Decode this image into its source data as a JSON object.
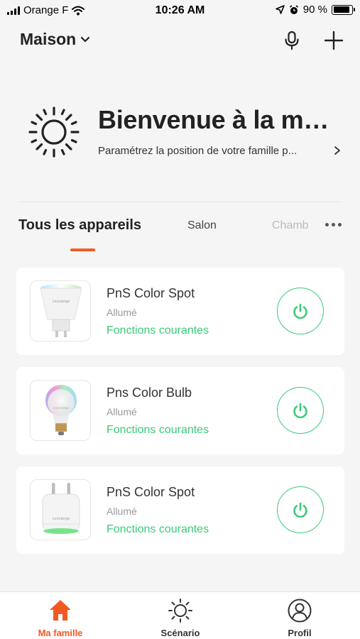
{
  "status_bar": {
    "carrier": "Orange F",
    "time": "10:26 AM",
    "battery": "90 %",
    "battery_level": 0.9
  },
  "header": {
    "home_name": "Maison"
  },
  "welcome": {
    "title": "Bienvenue à la mai...",
    "subtitle": "Paramétrez la position de votre famille p..."
  },
  "tabs": {
    "items": [
      {
        "label": "Tous les appareils",
        "active": true
      },
      {
        "label": "Salon",
        "active": false
      },
      {
        "label": "Chamb",
        "active": false
      }
    ]
  },
  "devices": [
    {
      "name": "PnS Color Spot",
      "status": "Allumé",
      "functions": "Fonctions courantes",
      "thumbnail": "spot-bulb",
      "power_on": true
    },
    {
      "name": "Pns Color Bulb",
      "status": "Allumé",
      "functions": "Fonctions courantes",
      "thumbnail": "color-bulb",
      "power_on": true
    },
    {
      "name": "PnS Color Spot",
      "status": "Allumé",
      "functions": "Fonctions courantes",
      "thumbnail": "smart-plug",
      "power_on": true
    }
  ],
  "bottom_nav": {
    "items": [
      {
        "label": "Ma famille",
        "icon": "home-icon",
        "active": true
      },
      {
        "label": "Scénario",
        "icon": "sun-icon",
        "active": false
      },
      {
        "label": "Profil",
        "icon": "user-icon",
        "active": false
      }
    ]
  },
  "colors": {
    "accent": "#f05a22",
    "power_green": "#3cc97a",
    "background": "#f5f5f5"
  }
}
